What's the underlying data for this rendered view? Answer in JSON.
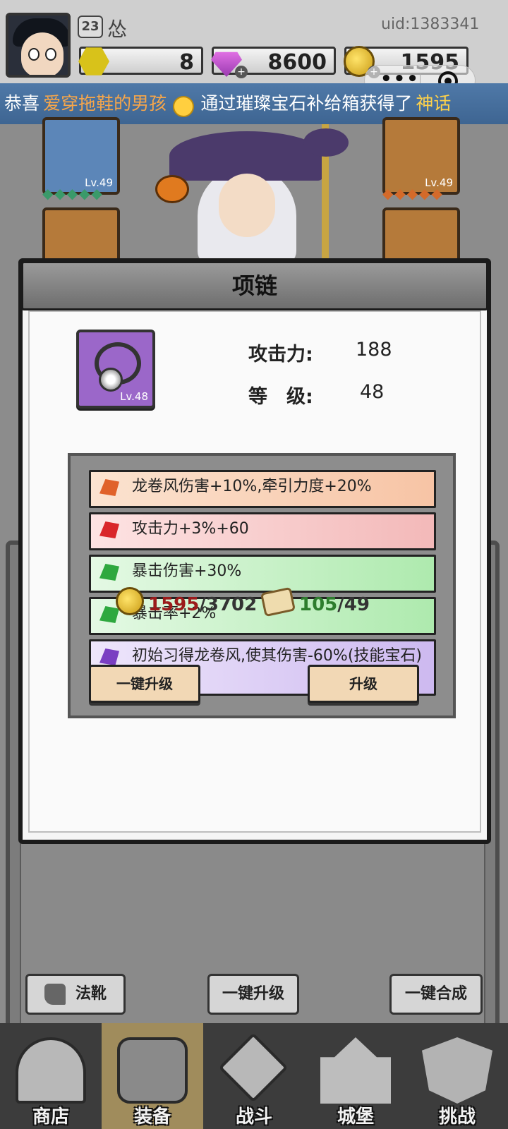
{
  "player": {
    "level": "23",
    "name": "怂",
    "uid": "uid:1383341",
    "hex_currency": "8",
    "gems": "8600",
    "coins": "1595"
  },
  "marquee": {
    "part1": "恭喜",
    "user": "爱穿拖鞋的男孩",
    "part2": "通过璀璨宝石补给箱获得了",
    "reward": "神话"
  },
  "scene": {
    "slot_left_top_lv": "Lv.49",
    "slot_right_top_lv": "Lv.49",
    "gems_left": "◆◆◆◆◆",
    "gems_right": "◆◆◆◆◆"
  },
  "dialog": {
    "title": "项链",
    "item_lv": "Lv.48",
    "attack_label": "攻击力:",
    "attack_value": "188",
    "level_label": "等　级:",
    "level_value": "48",
    "attributes": [
      "龙卷风伤害+10%,牵引力度+20%",
      "攻击力+3%+60",
      "暴击伤害+30%",
      "暴击率+2%",
      "初始习得龙卷风,使其伤害-60%(技能宝石)"
    ],
    "coin_have": "1595",
    "coin_need": "/3702",
    "scroll_have": "105",
    "scroll_need": "/49",
    "btn_upgrade_all": "一键升级",
    "btn_upgrade": "升级"
  },
  "actions": {
    "boots": "法靴",
    "upgrade_all": "一键升级",
    "merge_all": "一键合成"
  },
  "nav": {
    "shop": "商店",
    "equip": "装备",
    "battle": "战斗",
    "castle": "城堡",
    "challenge": "挑战"
  },
  "colors": {
    "marquee_bg": "#4f79a8",
    "dialog_button": "#f2d8b5",
    "coin_red": "#9b1b1b",
    "scroll_green": "#2e7d2e"
  }
}
